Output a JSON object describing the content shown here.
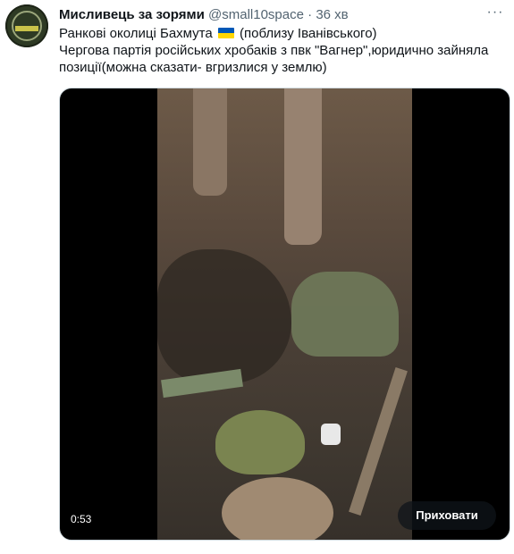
{
  "tweet": {
    "author_name": "Мисливець за зорями",
    "handle": "@small10space",
    "separator": "·",
    "time": "36 хв",
    "more_icon": "more-dots-icon",
    "text_line1_a": "Ранкові околиці Бахмута",
    "text_line1_b": "(поблизу Іванівського)",
    "text_line2": "Чергова партія російських хробаків з пвк \"Вагнер\",юридично зайняла позиції(можна сказати- вгризлися у землю)",
    "flag": "ukraine-flag-icon",
    "flag_colors": {
      "top": "#0057b7",
      "bottom": "#ffd700"
    }
  },
  "media": {
    "timestamp": "0:53",
    "hide_button_label": "Приховати"
  },
  "colors": {
    "text": "#0f1419",
    "secondary_text": "#536471",
    "media_background": "#000000"
  }
}
